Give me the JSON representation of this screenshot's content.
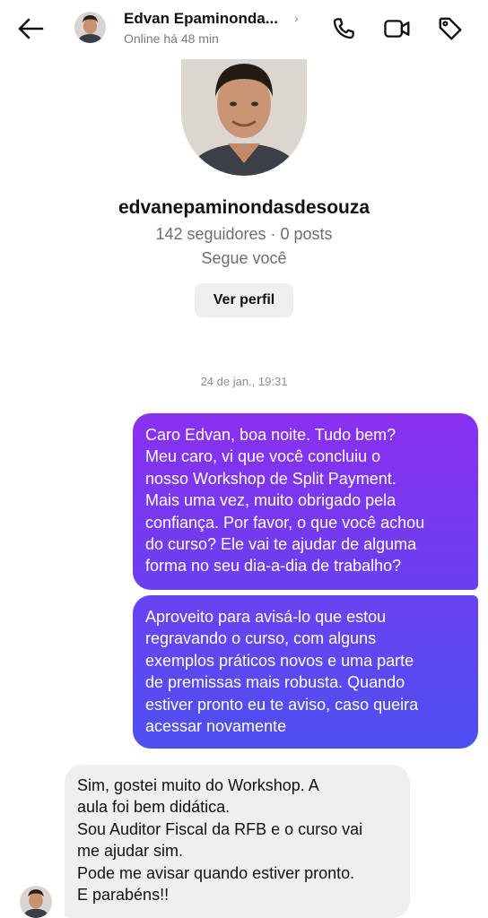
{
  "header": {
    "back_icon": "arrow-left-icon",
    "name": "Edvan Epaminonda...",
    "chevron": "›",
    "status": "Online há 48 min",
    "icons": [
      "phone-icon",
      "video-camera-icon",
      "tag-icon"
    ]
  },
  "profile": {
    "username": "edvanepaminondasdesouza",
    "stats": "142 seguidores · 0 posts",
    "follows": "Segue você",
    "view_profile_label": "Ver perfil"
  },
  "conversation": {
    "timestamp": "24 de jan., 19:31",
    "messages": [
      {
        "direction": "outgoing",
        "lines": [
          "Caro Edvan, boa noite. Tudo bem?",
          "Meu caro, vi que você concluiu o",
          "nosso Workshop de Split Payment.",
          "Mais uma vez, muito obrigado pela",
          "confiança. Por favor, o que você achou",
          "do curso? Ele vai te ajudar de alguma",
          "forma no seu dia-a-dia de trabalho?"
        ]
      },
      {
        "direction": "outgoing",
        "lines": [
          "Aproveito para avisá-lo que estou",
          "regravando o curso, com alguns",
          "exemplos práticos novos e uma parte",
          "de premissas mais robusta. Quando",
          "estiver pronto eu te aviso, caso queira",
          "acessar novamente"
        ]
      },
      {
        "direction": "incoming",
        "lines": [
          "Sim, gostei muito do Workshop. A",
          "aula foi bem didática.",
          "Sou Auditor Fiscal da RFB e o curso vai",
          "me ajudar sim.",
          "Pode me avisar quando estiver pronto.",
          "E parabéns!!"
        ]
      }
    ]
  },
  "colors": {
    "outgoing_top": "#8a30f0",
    "outgoing_bottom": "#4d4ff0",
    "incoming_bg": "#efefef",
    "button_bg": "#efefef",
    "muted_text": "#6d6d6d"
  }
}
